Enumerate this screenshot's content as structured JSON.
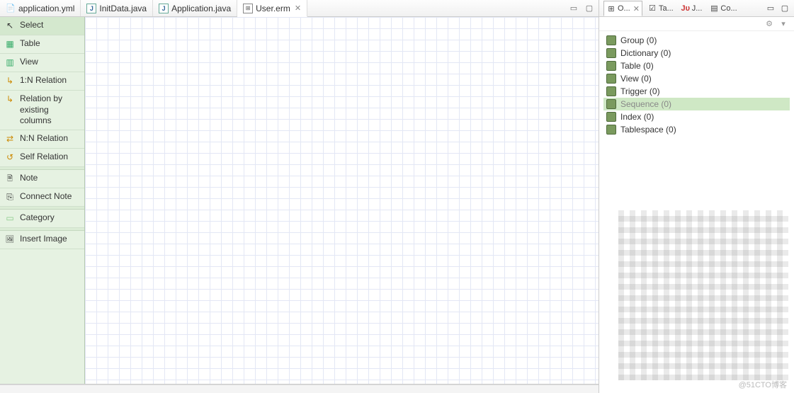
{
  "tabs": [
    {
      "label": "application.yml",
      "iconClass": "icon-file-yml",
      "active": false
    },
    {
      "label": "InitData.java",
      "iconClass": "icon-file-java",
      "active": false
    },
    {
      "label": "Application.java",
      "iconClass": "icon-file-java",
      "active": false
    },
    {
      "label": "User.erm",
      "iconClass": "icon-file-erm",
      "active": true
    }
  ],
  "palette": {
    "items": [
      {
        "label": "Select",
        "iconClass": "pi-select",
        "selected": true
      },
      {
        "label": "Table",
        "iconClass": "pi-table"
      },
      {
        "label": "View",
        "iconClass": "pi-view"
      },
      {
        "label": "1:N Relation",
        "iconClass": "pi-rel1n"
      },
      {
        "label": "Relation by existing columns",
        "iconClass": "pi-relex"
      },
      {
        "label": "N:N Relation",
        "iconClass": "pi-relnn"
      },
      {
        "label": "Self Relation",
        "iconClass": "pi-selfrel"
      },
      {
        "sep": true
      },
      {
        "label": "Note",
        "iconClass": "pi-note"
      },
      {
        "label": "Connect Note",
        "iconClass": "pi-cnote"
      },
      {
        "sep": true
      },
      {
        "label": "Category",
        "iconClass": "pi-category"
      },
      {
        "sep": true
      },
      {
        "label": "Insert Image",
        "iconClass": "pi-image"
      }
    ]
  },
  "rightTabs": [
    {
      "label": "O...",
      "iconKey": "outline",
      "active": true
    },
    {
      "label": "Ta...",
      "iconKey": "tasks"
    },
    {
      "label": "J...",
      "iconKey": "junit"
    },
    {
      "label": "Co...",
      "iconKey": "console"
    }
  ],
  "outline": {
    "items": [
      {
        "label": "Group (0)"
      },
      {
        "label": "Dictionary (0)"
      },
      {
        "label": "Table (0)"
      },
      {
        "label": "View (0)"
      },
      {
        "label": "Trigger (0)"
      },
      {
        "label": "Sequence (0)",
        "selected": true
      },
      {
        "label": "Index (0)"
      },
      {
        "label": "Tablespace (0)"
      }
    ]
  },
  "watermark_caption": "@51CTO博客"
}
